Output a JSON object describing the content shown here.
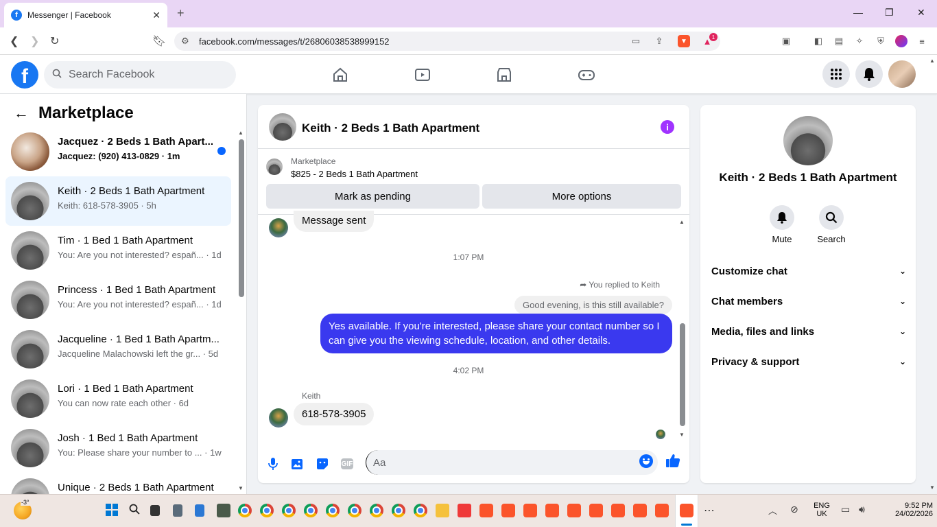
{
  "browser": {
    "tab_title": "Messenger | Facebook",
    "url": "facebook.com/messages/t/26806038538999152",
    "brave_badge": "1"
  },
  "header": {
    "search_placeholder": "Search Facebook"
  },
  "sidebar": {
    "title": "Marketplace",
    "conversations": [
      {
        "name": "Jacquez · 2 Beds 1 Bath Apart...",
        "preview": "Jacquez: (920) 413-0829 · 1m",
        "unread": true
      },
      {
        "name": "Keith · 2 Beds 1 Bath Apartment",
        "preview": "Keith: 618-578-3905 · 5h",
        "unread": false,
        "active": true
      },
      {
        "name": "Tim · 1 Bed 1 Bath Apartment",
        "preview": "You: Are you not interested? españ... · 1d",
        "unread": false
      },
      {
        "name": "Princess · 1 Bed 1 Bath Apartment",
        "preview": "You: Are you not interested? españ... · 1d",
        "unread": false
      },
      {
        "name": "Jacqueline · 1 Bed 1 Bath Apartm...",
        "preview": "Jacqueline Malachowski left the gr... · 5d",
        "unread": false
      },
      {
        "name": "Lori · 1 Bed 1 Bath Apartment",
        "preview": "You can now rate each other · 6d",
        "unread": false
      },
      {
        "name": "Josh · 1 Bed 1 Bath Apartment",
        "preview": "You: Please share your number to ... · 1w",
        "unread": false
      },
      {
        "name": "Unique · 2 Beds 1 Bath Apartment",
        "preview": "",
        "unread": false
      }
    ]
  },
  "chat": {
    "title": "Keith · 2 Beds 1 Bath Apartment",
    "listing_label": "Marketplace",
    "listing_price": "$825 - 2 Beds 1 Bath Apartment",
    "mark_pending_label": "Mark as pending",
    "more_options_label": "More options",
    "messages": {
      "message_sent": "Message sent",
      "time1": "1:07 PM",
      "reply_note": "You replied to Keith",
      "quoted": "Good evening, is this still available?",
      "outgoing": "Yes available. If you're interested, please share your contact number so I can give you the viewing schedule, location, and other details.",
      "time2": "4:02 PM",
      "sender": "Keith",
      "incoming": "618-578-3905"
    },
    "composer_placeholder": "Aa"
  },
  "details": {
    "name": "Keith · 2 Beds 1 Bath Apartment",
    "mute_label": "Mute",
    "search_label": "Search",
    "sections": [
      "Customize chat",
      "Chat members",
      "Media, files and links",
      "Privacy & support"
    ]
  },
  "taskbar": {
    "temp": "-3°",
    "lang_top": "ENG",
    "lang_bottom": "UK",
    "time": "9:52 PM",
    "date": "24/02/2026"
  }
}
